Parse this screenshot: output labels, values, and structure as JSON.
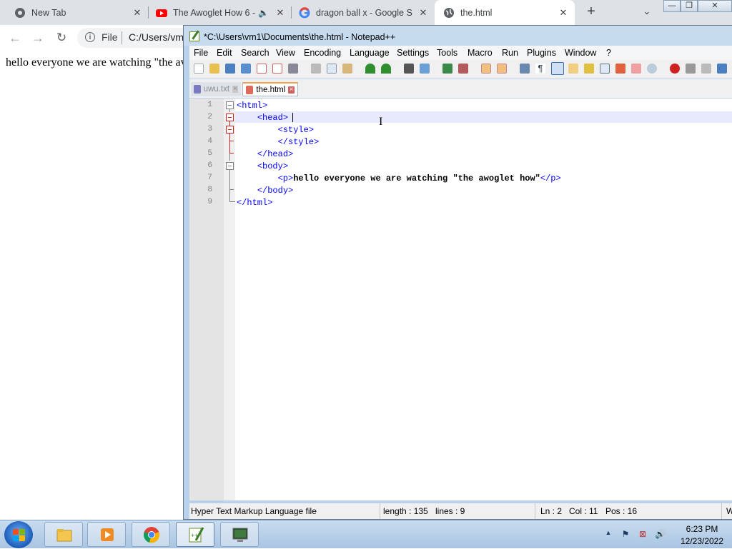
{
  "browser": {
    "tabs": [
      {
        "title": "New Tab",
        "close": "✕"
      },
      {
        "title": "The Awoglet How 6 -",
        "close": "✕"
      },
      {
        "title": "dragon ball x - Google S",
        "close": "✕"
      },
      {
        "title": "the.html",
        "close": "✕"
      }
    ],
    "new_tab": "+",
    "tab_list": "⌄",
    "address": {
      "scheme_label": "File",
      "url": "C:/Users/vm"
    },
    "page_text": "hello everyone we are watching \"the av"
  },
  "notepad": {
    "title": "*C:\\Users\\vm1\\Documents\\the.html - Notepad++",
    "menu": [
      "File",
      "Edit",
      "Search",
      "View",
      "Encoding",
      "Language",
      "Settings",
      "Tools",
      "Macro",
      "Run",
      "Plugins",
      "Window",
      "?"
    ],
    "doc_tabs": [
      {
        "name": "uwu.txt",
        "active": false
      },
      {
        "name": "the.html",
        "active": true
      }
    ],
    "lines": [
      {
        "num": "1",
        "indent": "",
        "code": "<html>",
        "tail": ""
      },
      {
        "num": "2",
        "indent": "    ",
        "code": "<head>",
        "tail": ""
      },
      {
        "num": "3",
        "indent": "        ",
        "code": "<style>",
        "tail": ""
      },
      {
        "num": "4",
        "indent": "        ",
        "code": "</style>",
        "tail": ""
      },
      {
        "num": "5",
        "indent": "    ",
        "code": "</head>",
        "tail": ""
      },
      {
        "num": "6",
        "indent": "    ",
        "code": "<body>",
        "tail": ""
      },
      {
        "num": "7",
        "indent": "        ",
        "code": "<p>",
        "text": "hello everyone we are watching \"the awoglet how\"",
        "tail": "</p>"
      },
      {
        "num": "8",
        "indent": "    ",
        "code": "</body>",
        "tail": ""
      },
      {
        "num": "9",
        "indent": "",
        "code": "</html>",
        "tail": ""
      }
    ],
    "status": {
      "file_type": "Hyper Text Markup Language file",
      "length": "length : 135",
      "lines": "lines : 9",
      "ln": "Ln : 2",
      "col": "Col : 11",
      "pos": "Pos : 16",
      "eol": "W"
    }
  },
  "window_controls": {
    "minimize": "—",
    "restore": "❐",
    "close": "✕"
  },
  "taskbar": {
    "apps": [
      "explorer",
      "media-player",
      "chrome",
      "notepad++",
      "terminal"
    ],
    "clock_time": "6:23 PM",
    "clock_date": "12/23/2022",
    "tray_expand": "▲"
  },
  "colors": {
    "tag": "#0000ff",
    "fold_red": "#cc2222",
    "active_tab_accent": "#f7a14b",
    "youtube_red": "#ff0000"
  }
}
